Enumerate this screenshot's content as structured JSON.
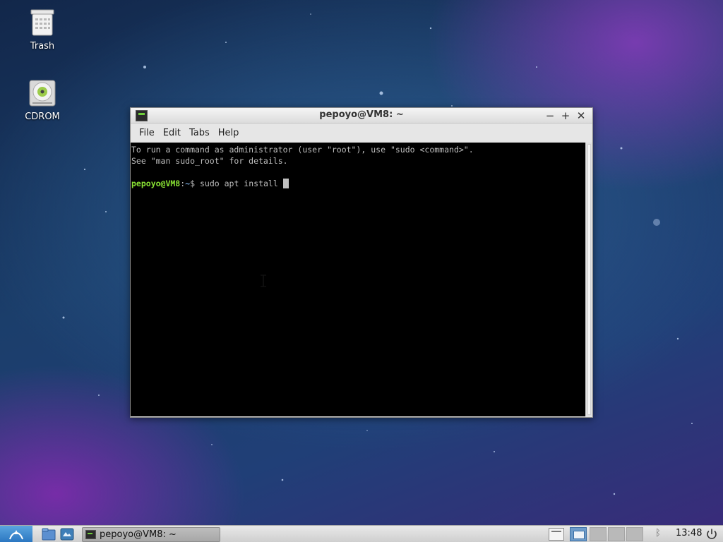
{
  "desktop": {
    "icons": [
      {
        "label": "Trash",
        "icon": "trash-icon"
      },
      {
        "label": "CDROM",
        "icon": "cdrom-icon"
      }
    ]
  },
  "window": {
    "title": "pepoyo@VM8: ~",
    "app_icon": "terminal-icon",
    "controls": {
      "minimize": "−",
      "maximize": "+",
      "close": "✕"
    },
    "menu": [
      "File",
      "Edit",
      "Tabs",
      "Help"
    ]
  },
  "terminal": {
    "lines": [
      "To run a command as administrator (user \"root\"), use \"sudo <command>\".",
      "See \"man sudo_root\" for details."
    ],
    "prompt_user": "pepoyo@VM8",
    "prompt_sep": ":",
    "prompt_path": "~",
    "prompt_symbol": "$ ",
    "command": "sudo apt install "
  },
  "taskbar": {
    "menu_icon": "start-menu-icon",
    "launchers": [
      "file-manager-icon",
      "browser-icon"
    ],
    "tasks": [
      {
        "label": "pepoyo@VM8: ~",
        "icon": "terminal-icon"
      }
    ],
    "workspaces": 4,
    "active_workspace": 1,
    "clock": "13:48",
    "tray": [
      "bluetooth-icon",
      "power-icon"
    ]
  }
}
